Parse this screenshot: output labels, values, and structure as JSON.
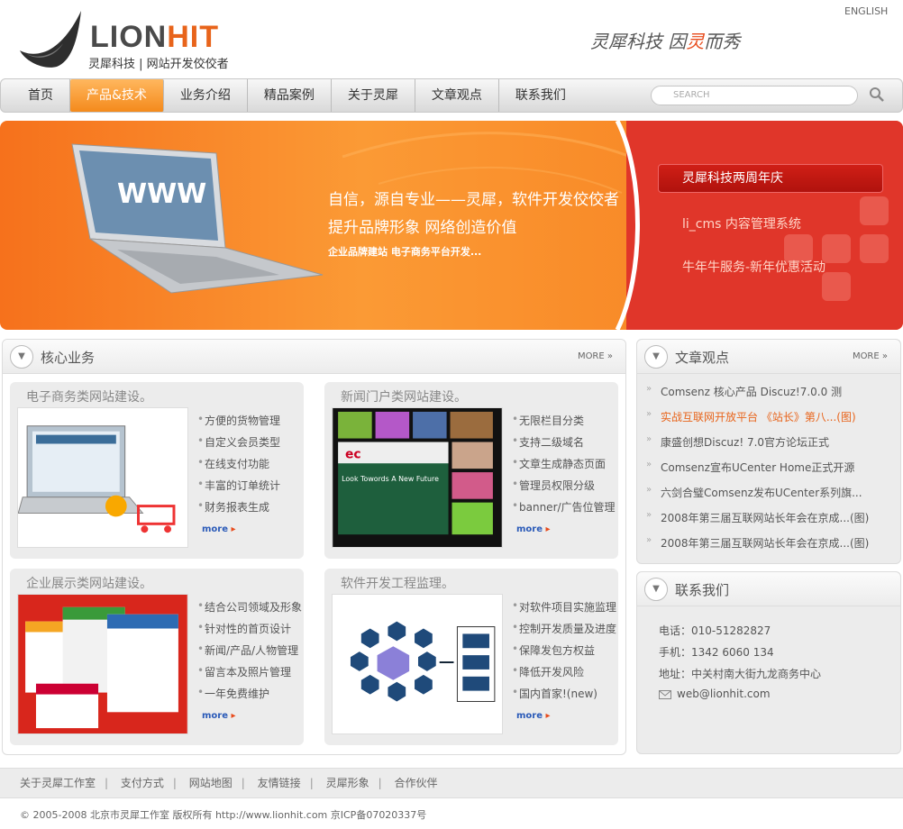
{
  "header": {
    "brand_part1": "LION",
    "brand_part2": "HIT",
    "subtitle": "灵犀科技 | 网站开发佼佼者",
    "slogan_a": "灵犀科技  因",
    "slogan_b": "灵",
    "slogan_c": "而秀",
    "english_link": "ENGLISH"
  },
  "nav": {
    "items": [
      "首页",
      "产品&技术",
      "业务介绍",
      "精品案例",
      "关于灵犀",
      "文章观点",
      "联系我们"
    ],
    "active_index": 1,
    "search_placeholder": "SEARCH"
  },
  "banner": {
    "line1": "自信，源自专业——灵犀，软件开发佼佼者",
    "line2": "提升品牌形象    网络创造价值",
    "line3": "企业品牌建站  电子商务平台开发...",
    "links": [
      "灵犀科技两周年庆",
      "li_cms 内容管理系统",
      "牛年牛服务-新年优惠活动"
    ],
    "screen_text": "WWW"
  },
  "core": {
    "title": "核心业务",
    "more": "MORE »",
    "cards": [
      {
        "title": "电子商务类网站建设。",
        "items": [
          "方便的货物管理",
          "自定义会员类型",
          "在线支付功能",
          "丰富的订单统计",
          "财务报表生成"
        ],
        "more": "more"
      },
      {
        "title": "新闻门户类网站建设。",
        "items": [
          "无限栏目分类",
          "支持二级域名",
          "文章生成静态页面",
          "管理员权限分级",
          "banner/广告位管理"
        ],
        "more": "more",
        "img_text": "Look Towords A New Future"
      },
      {
        "title": "企业展示类网站建设。",
        "items": [
          "结合公司领域及形象",
          "针对性的首页设计",
          "新闻/产品/人物管理",
          "留言本及照片管理",
          "一年免费维护"
        ],
        "more": "more"
      },
      {
        "title": "软件开发工程监理。",
        "items": [
          "对软件项目实施监理",
          "控制开发质量及进度",
          "保障发包方权益",
          "降低开发风险",
          "国内首家!(new)"
        ],
        "more": "more"
      }
    ]
  },
  "articles": {
    "title": "文章观点",
    "more": "MORE »",
    "items": [
      "Comsenz 核心产品 Discuz!7.0.0 测",
      "实战互联网开放平台 《站长》第八...(图)",
      "康盛创想Discuz! 7.0官方论坛正式",
      "Comsenz宣布UCenter Home正式开源",
      "六剑合璧Comsenz发布UCenter系列旗...",
      "2008年第三届互联网站长年会在京成...(图)",
      "2008年第三届互联网站长年会在京成...(图)"
    ],
    "hot_index": 1
  },
  "contact": {
    "title": "联系我们",
    "phone": "电话：010-51282827",
    "mobile": "手机：1342 6060 134",
    "address": "地址：中关村南大街九龙商务中心",
    "email": "web@lionhit.com"
  },
  "footer": {
    "links": [
      "关于灵犀工作室",
      "支付方式",
      "网站地图",
      "友情链接",
      "灵犀形象",
      "合作伙伴"
    ],
    "copyright": "© 2005-2008 北京市灵犀工作室 版权所有 http://www.lionhit.com 京ICP备07020337号"
  },
  "colors": {
    "accent": "#f48a1c",
    "banner_red": "#e0362a",
    "link_blue": "#2a5ab8"
  }
}
